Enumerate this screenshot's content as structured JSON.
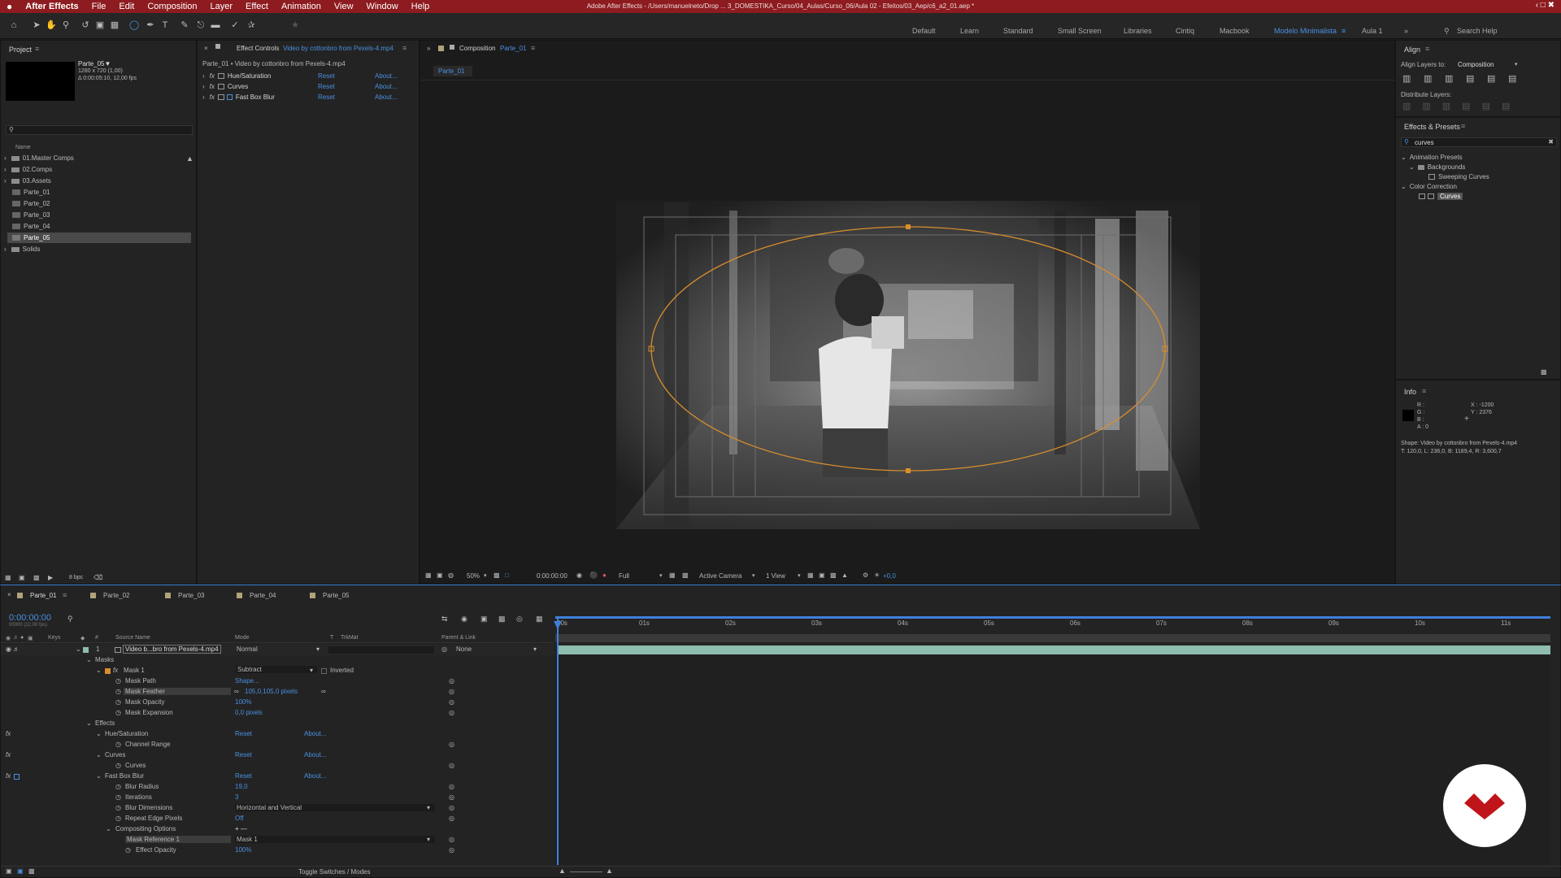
{
  "menubar": {
    "apple": "",
    "app": "After Effects",
    "items": [
      "File",
      "Edit",
      "Composition",
      "Layer",
      "Effect",
      "Animation",
      "View",
      "Window",
      "Help"
    ],
    "title": "Adobe After Effects - /Users/manuelneto/Drop ... 3_DOMESTIKA_Curso/04_Aulas/Curso_06/Aula 02 - Efeitos/03_Aep/c6_a2_01.aep *"
  },
  "workspaces": [
    "Default",
    "Learn",
    "Standard",
    "Small Screen",
    "Libraries",
    "Cintiq",
    "Macbook",
    "Modelo Minimalista",
    "Aula 1"
  ],
  "search_help": "Search Help",
  "project": {
    "title": "Project",
    "thumb_name": "Parte_05▼",
    "thumb_info1": "1280 x 720 (1,00)",
    "thumb_info2": "Δ 0:00:05:10, 12,00 fps",
    "col_name": "Name",
    "items": [
      "01.Master Comps",
      "02.Comps",
      "03.Assets",
      "Parte_01",
      "Parte_02",
      "Parte_03",
      "Parte_04",
      "Parte_05",
      "Solids"
    ],
    "bpc": "8 bpc"
  },
  "effect_controls": {
    "tab_prefix": "Effect Controls",
    "tab_layer": "Video by cottonbro from Pexels-4.mp4",
    "header": "Parte_01 • Video by cottonbro from Pexels-4.mp4",
    "effects": [
      {
        "name": "Hue/Saturation",
        "reset": "Reset",
        "about": "About..."
      },
      {
        "name": "Curves",
        "reset": "Reset",
        "about": "About..."
      },
      {
        "name": "Fast Box Blur",
        "reset": "Reset",
        "about": "About..."
      }
    ]
  },
  "composition": {
    "tab_prefix": "Composition",
    "tab_name": "Parte_01",
    "sub_tab": "Parte_01",
    "zoom": "50%",
    "timecode": "0:00:00:00",
    "resolution": "Full",
    "camera": "Active Camera",
    "views": "1 View",
    "exposure": "+0,0"
  },
  "align": {
    "title": "Align",
    "align_to_label": "Align Layers to:",
    "align_to_value": "Composition",
    "distribute_label": "Distribute Layers:"
  },
  "effects_presets": {
    "title": "Effects & Presets",
    "search": "curves",
    "tree": [
      "Animation Presets",
      "Backgrounds",
      "Sweeping Curves",
      "Color Correction",
      "Curves"
    ]
  },
  "info": {
    "title": "Info",
    "r": "R :",
    "g": "G :",
    "b": "B :",
    "a": "A : 0",
    "x": "X : -1200",
    "y": "Y : 2376",
    "shape_line1": "Shape: Video by cottonbro from Pexels-4.mp4",
    "shape_line2": "T: 120,0, L: 236,0, B: 1189,4, R: 3,600,7"
  },
  "timeline": {
    "tabs": [
      "Parte_01",
      "Parte_02",
      "Parte_03",
      "Parte_04",
      "Parte_05"
    ],
    "timecode": "0:00:00:00",
    "timecode_sub": "00000 (12,00 fps)",
    "col_keys": "Keys",
    "col_num": "#",
    "col_source": "Source Name",
    "col_mode": "Mode",
    "col_t": "T",
    "col_trkmat": "TrkMat",
    "col_parent": "Parent & Link",
    "layer_num": "1",
    "layer_name": "Video b...bro from Pexels-4.mp4",
    "layer_mode": "Normal",
    "layer_parent": "None",
    "masks": "Masks",
    "mask1": "Mask 1",
    "mask1_mode": "Subtract",
    "mask1_inverted": "Inverted",
    "mask_path": "Mask Path",
    "mask_path_val": "Shape...",
    "mask_feather": "Mask Feather",
    "mask_feather_val": "105,0,105,0 pixels",
    "mask_opacity": "Mask Opacity",
    "mask_opacity_val": "100%",
    "mask_expansion": "Mask Expansion",
    "mask_expansion_val": "0,0 pixels",
    "effects": "Effects",
    "hue_sat": "Hue/Saturation",
    "channel_range": "Channel Range",
    "curves": "Curves",
    "curves_prop": "Curves",
    "fbb": "Fast Box Blur",
    "blur_radius": "Blur Radius",
    "blur_radius_val": "19,0",
    "iterations": "Iterations",
    "iterations_val": "3",
    "blur_dim": "Blur Dimensions",
    "blur_dim_val": "Horizontal and Vertical",
    "repeat_edge": "Repeat Edge Pixels",
    "repeat_edge_val": "Off",
    "compositing": "Compositing Options",
    "compositing_val": "+ —",
    "mask_ref": "Mask Reference 1",
    "mask_ref_val": "Mask 1",
    "effect_opacity": "Effect Opacity",
    "effect_opacity_val": "100%",
    "reset": "Reset",
    "about": "About...",
    "ruler": [
      "00s",
      "01s",
      "02s",
      "03s",
      "04s",
      "05s",
      "06s",
      "07s",
      "08s",
      "09s",
      "10s",
      "11s"
    ],
    "toggle": "Toggle Switches / Modes"
  },
  "colors": {
    "menubar": "#8d1b1f",
    "accent": "#4a90e2",
    "mask_path": "#d98e2d",
    "layer_bar": "#8fbdb0",
    "playhead": "#3f7fd9",
    "logo": "#c0141b"
  }
}
